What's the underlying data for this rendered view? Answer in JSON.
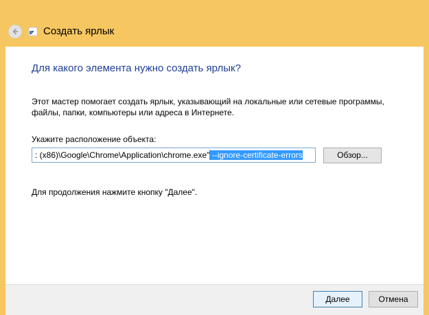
{
  "window": {
    "title": "Создать ярлык",
    "accent_color": "#f6c660"
  },
  "icons": {
    "back": "back-arrow-icon",
    "app": "shortcut-icon"
  },
  "content": {
    "heading": "Для какого элемента нужно создать ярлык?",
    "description": "Этот мастер помогает создать ярлык, указывающий на локальные или сетевые программы, файлы, папки, компьютеры или адреса в Интернете.",
    "location_label": "Укажите расположение объекта:",
    "location_value_plain": ": (x86)\\Google\\Chrome\\Application\\chrome.exe\"",
    "location_value_selected": " --ignore-certificate-errors",
    "browse_label": "Обзор...",
    "hint": "Для продолжения нажмите кнопку \"Далее\"."
  },
  "footer": {
    "next_label": "Далее",
    "cancel_label": "Отмена"
  }
}
